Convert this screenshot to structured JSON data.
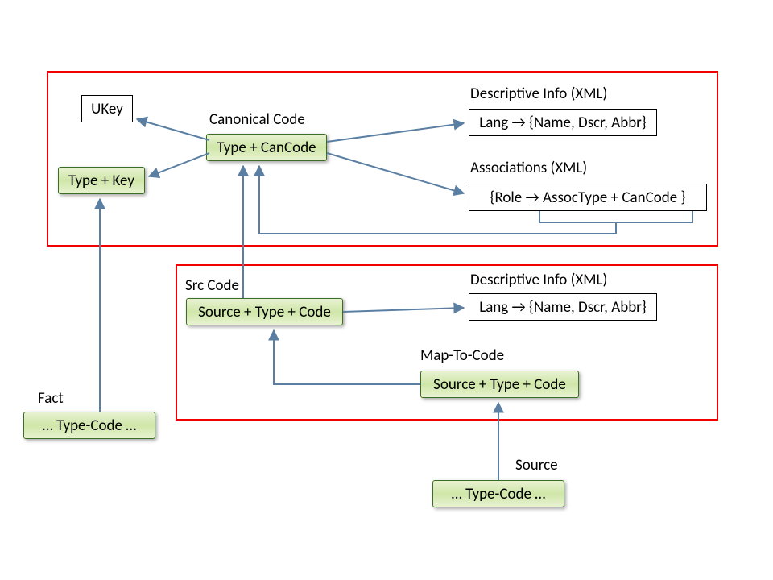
{
  "labels": {
    "canonical_code": "Canonical Code",
    "descriptive_info_1": "Descriptive Info (XML)",
    "associations": "Associations (XML)",
    "src_code": "Src Code",
    "descriptive_info_2": "Descriptive Info (XML)",
    "map_to_code": "Map-To-Code",
    "fact": "Fact",
    "source": "Source"
  },
  "boxes": {
    "ukey": "UKey",
    "type_cancode": "Type + CanCode",
    "lang_map_1": "Lang → {Name, Dscr, Abbr}",
    "type_key": "Type + Key",
    "role_map": "{Role → AssocType + CanCode }",
    "source_type_code_1": "Source + Type + Code",
    "lang_map_2": "Lang → {Name, Dscr, Abbr}",
    "source_type_code_2": "Source + Type + Code",
    "fact_tc": "…  Type-Code  …",
    "source_tc": "…  Type-Code  …"
  }
}
